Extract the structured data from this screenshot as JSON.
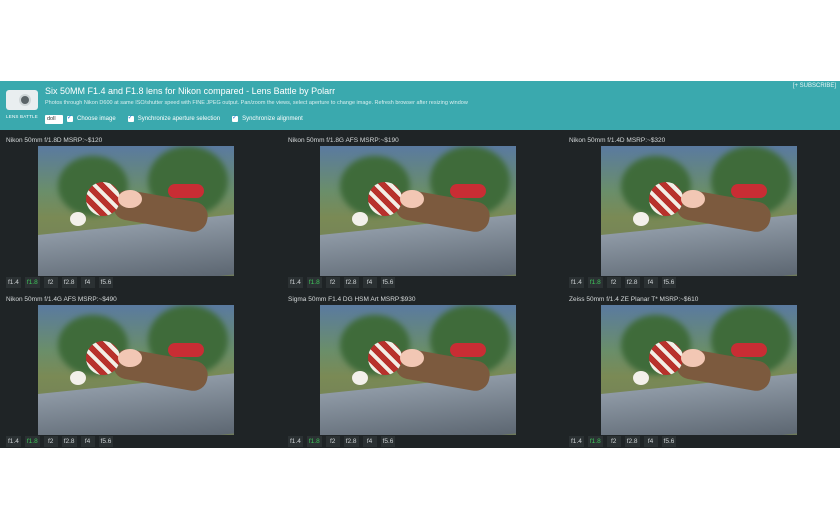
{
  "header": {
    "title": "Six 50MM F1.4 and F1.8 lens for Nikon compared - Lens Battle by Polarr",
    "subtitle": "Photos through Nikon D600 at same ISO/shutter speed with FINE JPEG output. Pan/zoom the views, select aperture to change image. Refresh browser after resizing window",
    "subscribe": "[+ SUBSCRIBE]",
    "logo_text": "LENS BATTLE",
    "image_select_value": "doll",
    "choose_image_label": "Choose image",
    "sync_aperture_label": "Synchronize aperture selection",
    "sync_alignment_label": "Synchronize alignment"
  },
  "apertures": [
    "f1.4",
    "f1.8",
    "f2",
    "f2.8",
    "f4",
    "f5.6"
  ],
  "active_aperture": "f1.8",
  "panels": [
    {
      "title": "Nikon 50mm f/1.8D MSRP:~$120"
    },
    {
      "title": "Nikon 50mm f/1.8G AFS MSRP:~$190"
    },
    {
      "title": "Nikon 50mm f/1.4D MSRP:~$320"
    },
    {
      "title": "Nikon 50mm f/1.4G AFS MSRP:~$490"
    },
    {
      "title": "Sigma 50mm F1.4 DG HSM Art MSRP:$930"
    },
    {
      "title": "Zeiss 50mm f/1.4 ZE Planar T* MSRP:~$610"
    }
  ]
}
